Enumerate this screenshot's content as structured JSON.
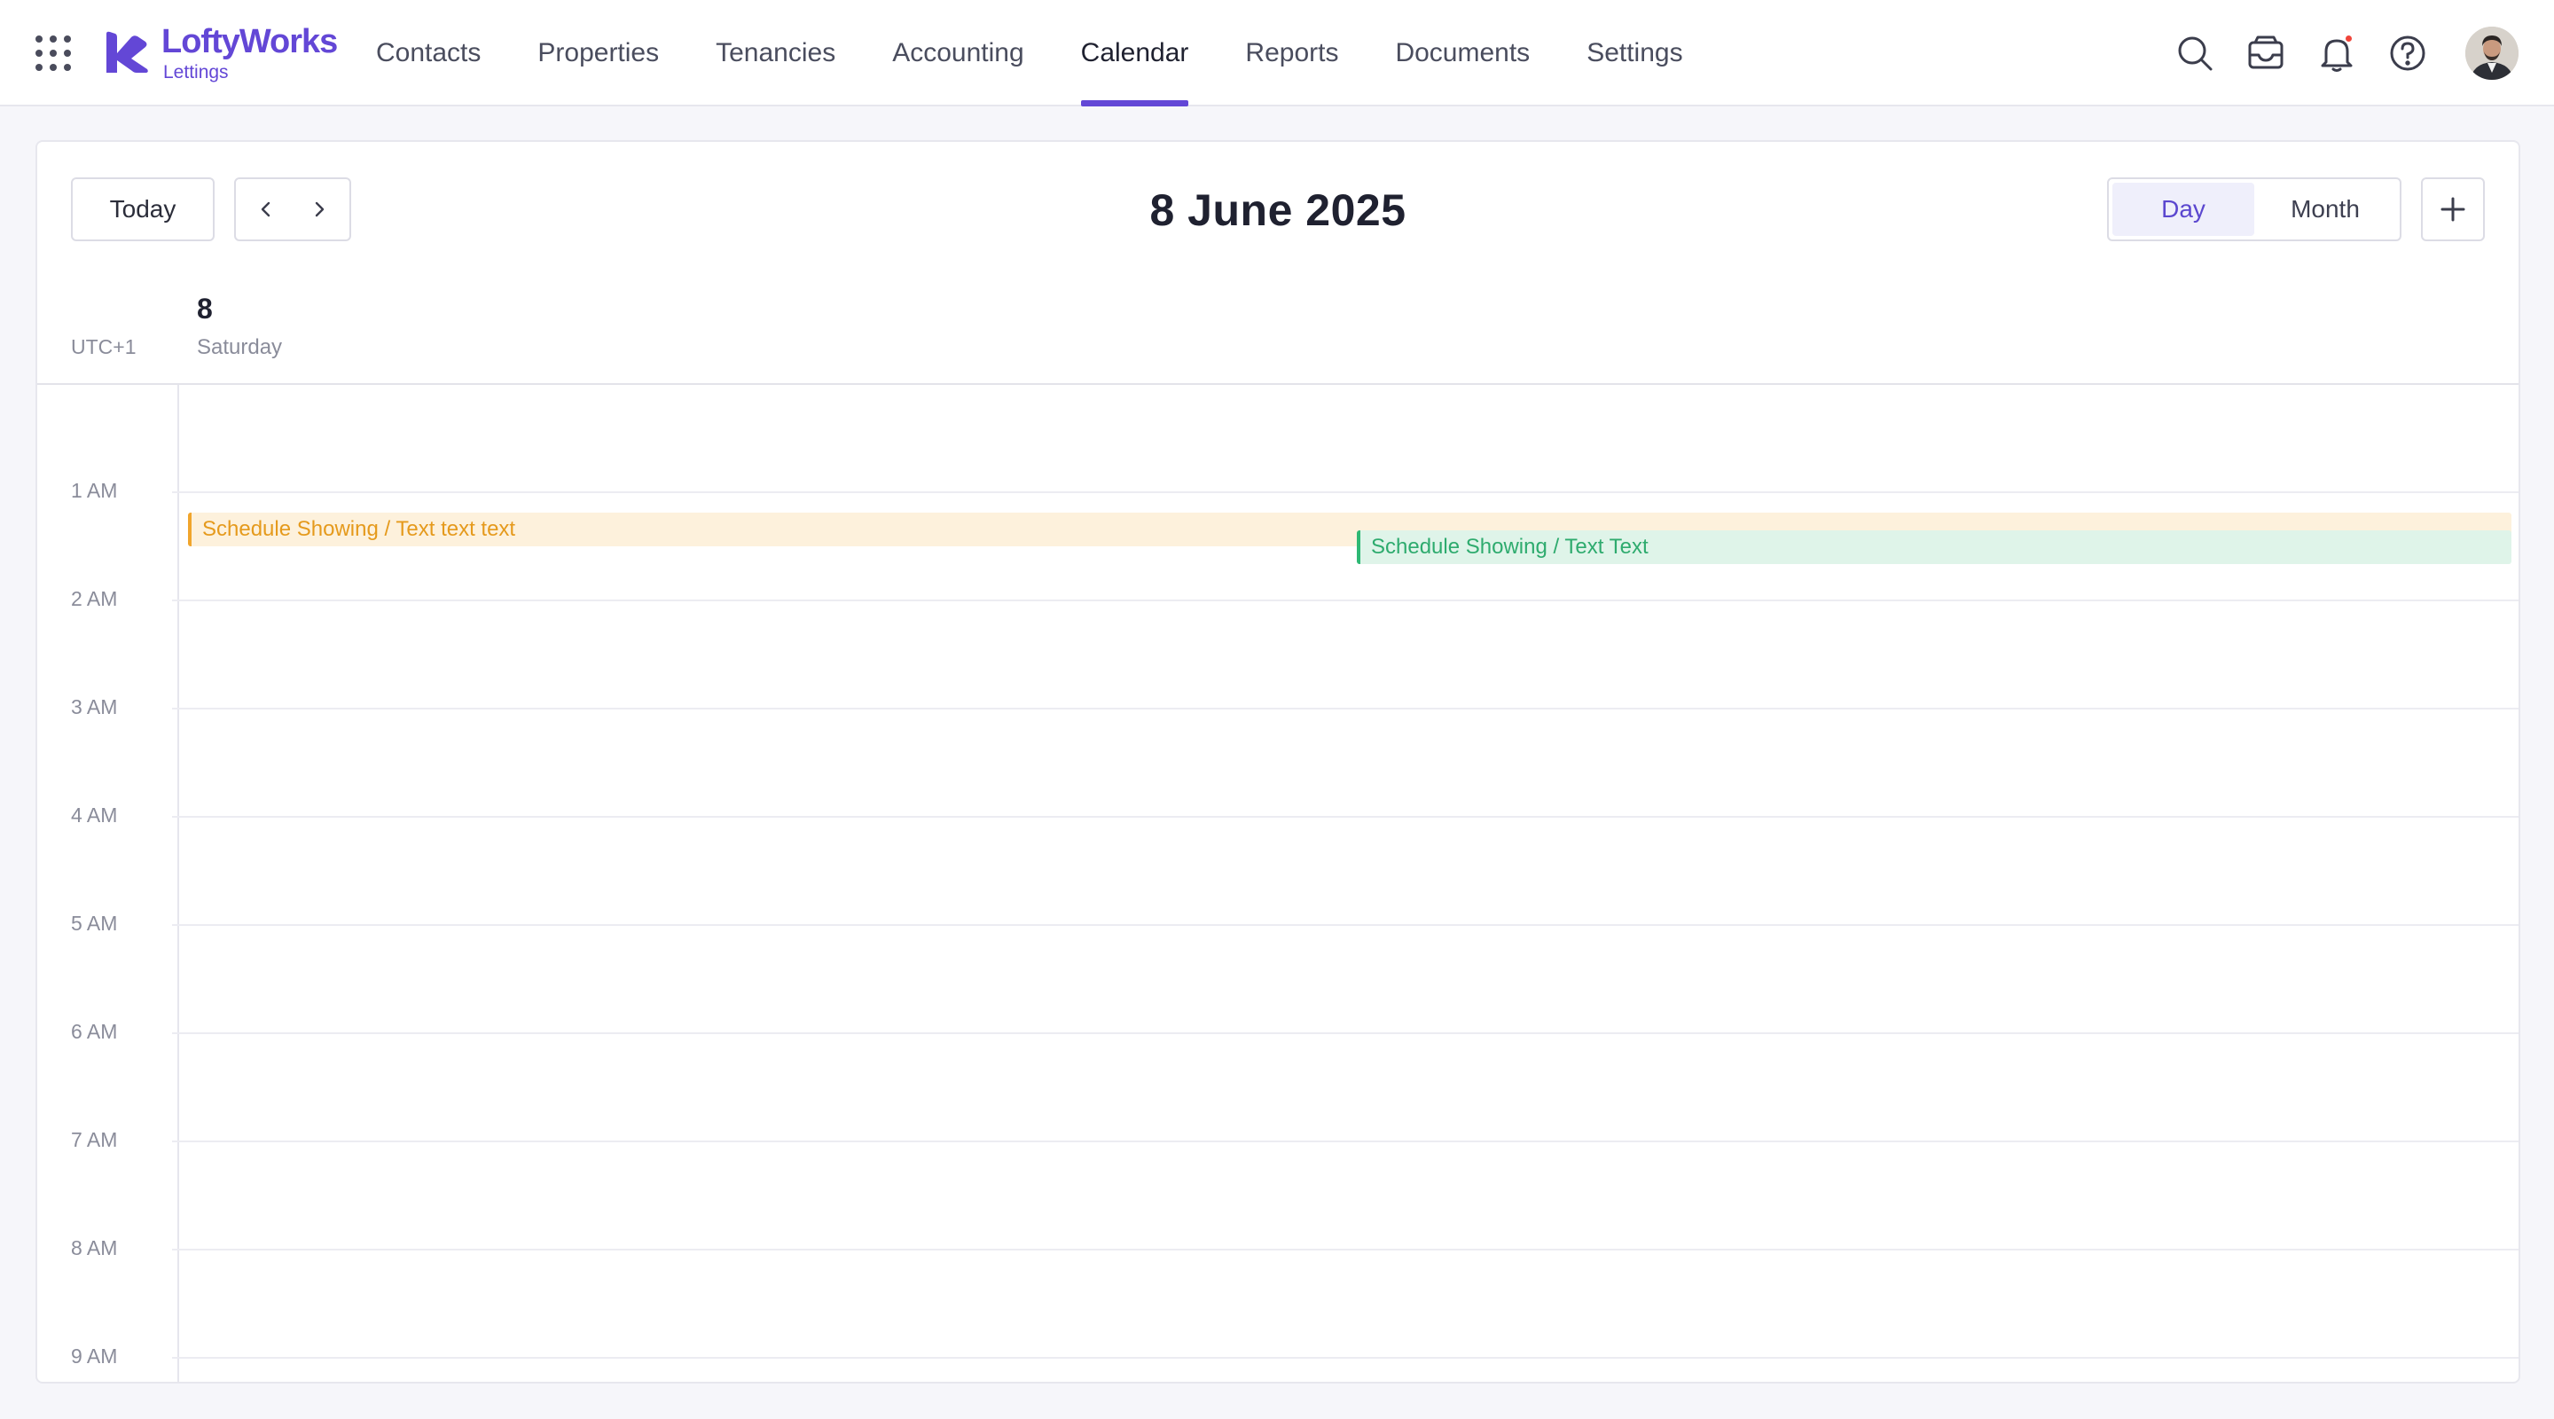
{
  "brand": {
    "name": "LoftyWorks",
    "sub": "Lettings",
    "color": "#6347d6"
  },
  "nav": {
    "items": [
      {
        "label": "Contacts"
      },
      {
        "label": "Properties"
      },
      {
        "label": "Tenancies"
      },
      {
        "label": "Accounting"
      },
      {
        "label": "Calendar",
        "active": true
      },
      {
        "label": "Reports"
      },
      {
        "label": "Documents"
      },
      {
        "label": "Settings"
      }
    ]
  },
  "top_icons": [
    "search-icon",
    "inbox-icon",
    "bell-icon",
    "help-icon"
  ],
  "toolbar": {
    "today_label": "Today",
    "title": "8 June 2025",
    "views": [
      {
        "label": "Day",
        "active": true
      },
      {
        "label": "Month",
        "active": false
      }
    ]
  },
  "day_header": {
    "timezone": "UTC+1",
    "day_number": "8",
    "day_name": "Saturday"
  },
  "hours": [
    "1 AM",
    "2 AM",
    "3 AM",
    "4 AM",
    "5 AM",
    "6 AM",
    "7 AM",
    "8 AM",
    "9 AM"
  ],
  "events": [
    {
      "title": "Schedule Showing / Text text text",
      "color": "#f1a52c"
    },
    {
      "title": "Schedule Showing / Text Text",
      "color": "#2eb874"
    }
  ]
}
